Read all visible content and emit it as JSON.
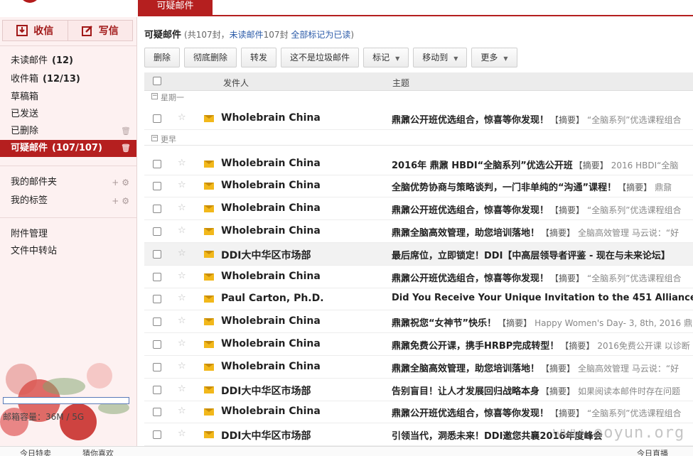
{
  "tabs": {
    "active_label": "可疑邮件"
  },
  "sidebar": {
    "receive_label": "收信",
    "compose_label": "写信",
    "folders": [
      {
        "label": "未读邮件",
        "count": "(12)"
      },
      {
        "label": "收件箱",
        "count": "(12/13)"
      },
      {
        "label": "草稿箱",
        "count": ""
      },
      {
        "label": "已发送",
        "count": ""
      },
      {
        "label": "已删除",
        "count": ""
      },
      {
        "label": "可疑邮件",
        "count": "(107/107)"
      }
    ],
    "my_folders_label": "我的邮件夹",
    "my_tags_label": "我的标签",
    "attachments_label": "附件管理",
    "file_transfer_label": "文件中转站",
    "storage_text": "邮箱容量：36M / 5G",
    "storage_fraction": 0.007
  },
  "main": {
    "title": "可疑邮件",
    "summary_prefix": "(共107封，",
    "unread_link": "未读邮件",
    "unread_count": "107封",
    "mark_all_link": "全部标记为已读",
    "summary_suffix": ")",
    "toolbar": {
      "delete": "删除",
      "permanent_delete": "彻底删除",
      "forward": "转发",
      "not_spam": "这不是垃圾邮件",
      "mark": "标记",
      "move_to": "移动到",
      "more": "更多"
    },
    "columns": {
      "sender": "发件人",
      "subject": "主题"
    },
    "groups": [
      {
        "label": "星期一"
      },
      {
        "label": "更早"
      }
    ],
    "emails": [
      {
        "sender": "Wholebrain China",
        "subject": "鼎鼐公开班优选组合，惊喜等你发现！",
        "tag": "【摘要】",
        "preview": "“全脑系列”优选课程组合"
      },
      {
        "sender": "Wholebrain China",
        "subject": "2016年 鼎鼐 HBDI“全脑系列”优选公开班",
        "tag": "【摘要】",
        "preview": "2016 HBDI“全脑"
      },
      {
        "sender": "Wholebrain China",
        "subject": "全脑优势协商与策略谈判，一门非单纯的“沟通”课程！",
        "tag": "【摘要】",
        "preview": "鼎鼐"
      },
      {
        "sender": "Wholebrain China",
        "subject": "鼎鼐公开班优选组合，惊喜等你发现！",
        "tag": "【摘要】",
        "preview": "“全脑系列”优选课程组合"
      },
      {
        "sender": "Wholebrain China",
        "subject": "鼎鼐全脑高效管理，助您培训落地！",
        "tag": "【摘要】",
        "preview": "全脑高效管理 马云说：“好"
      },
      {
        "sender": "DDI大中华区市场部",
        "subject": "最后席位，立即锁定！DDI【中高层领导者评鉴 - 现在与未来论坛】",
        "tag": "",
        "preview": "",
        "highlight": true
      },
      {
        "sender": "Wholebrain China",
        "subject": "鼎鼐公开班优选组合，惊喜等你发现！",
        "tag": "【摘要】",
        "preview": "“全脑系列”优选课程组合"
      },
      {
        "sender": "Paul Carton, Ph.D.",
        "subject": "Did You Receive Your Unique Invitation to the 451 Alliance?",
        "tag": "",
        "preview": ""
      },
      {
        "sender": "Wholebrain China",
        "subject": "鼎鼐祝您“女神节”快乐！",
        "tag": "【摘要】",
        "preview": "Happy Women's Day- 3, 8th, 2016 鼎"
      },
      {
        "sender": "Wholebrain China",
        "subject": "鼎鼐免费公开课，携手HRBP完成转型！",
        "tag": "【摘要】",
        "preview": "2016免费公开课 以诊断"
      },
      {
        "sender": "Wholebrain China",
        "subject": "鼎鼐全脑高效管理，助您培训落地！",
        "tag": "【摘要】",
        "preview": "全脑高效管理 马云说：“好"
      },
      {
        "sender": "DDI大中华区市场部",
        "subject": "告别盲目！让人才发展回归战略本身",
        "tag": "【摘要】",
        "preview": "如果阅读本邮件时存在问题"
      },
      {
        "sender": "Wholebrain China",
        "subject": "鼎鼐公开班优选组合，惊喜等你发现！",
        "tag": "【摘要】",
        "preview": "“全脑系列”优选课程组合"
      },
      {
        "sender": "DDI大中华区市场部",
        "subject": "引领当代，洞悉未来！DDI邀您共襄2016年度峰会",
        "tag": "",
        "preview": ""
      }
    ]
  },
  "bottom": {
    "item1": "今日特卖",
    "item2": "猜你喜欢",
    "item3": "今日直播"
  },
  "watermark": "www.ooyun.org",
  "colors": {
    "accent": "#b51f1f",
    "envelope": "#f2b81b",
    "link": "#2a5aa8"
  }
}
